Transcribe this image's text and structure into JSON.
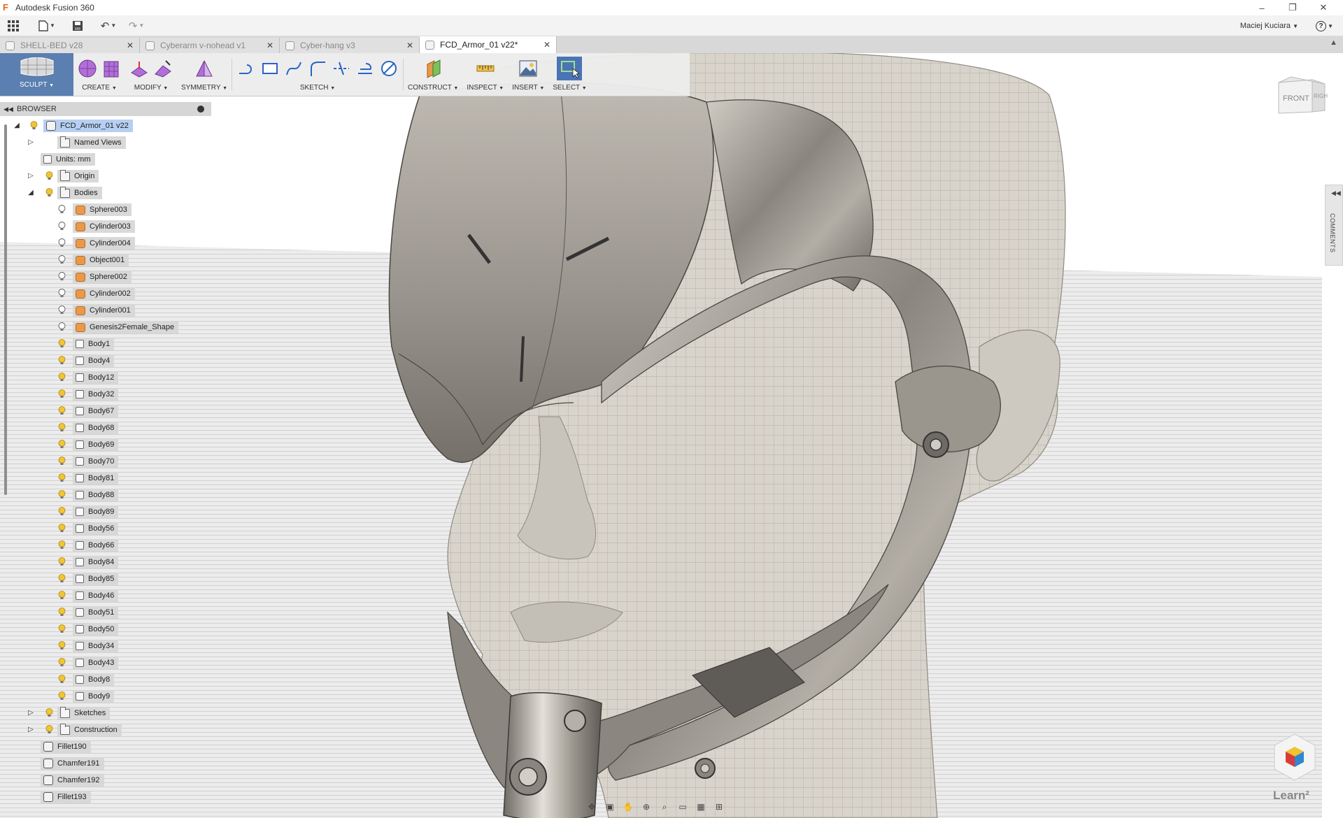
{
  "window": {
    "title": "Autodesk Fusion 360",
    "controls": [
      "–",
      "❐",
      "✕"
    ]
  },
  "quick_access": {
    "user_name": "Maciej Kuciara",
    "help_label": "?"
  },
  "tabs": [
    {
      "label": "SHELL-BED v28",
      "active": false
    },
    {
      "label": "Cyberarm v-nohead v1",
      "active": false
    },
    {
      "label": "Cyber-hang v3",
      "active": false
    },
    {
      "label": "FCD_Armor_01 v22*",
      "active": true
    }
  ],
  "toolbar": {
    "groups": [
      {
        "label": "SCULPT",
        "name": "sculpt"
      },
      {
        "label": "CREATE",
        "name": "create"
      },
      {
        "label": "MODIFY",
        "name": "modify"
      },
      {
        "label": "SYMMETRY",
        "name": "symmetry"
      },
      {
        "label": "SKETCH",
        "name": "sketch"
      },
      {
        "label": "CONSTRUCT",
        "name": "construct"
      },
      {
        "label": "INSPECT",
        "name": "inspect"
      },
      {
        "label": "INSERT",
        "name": "insert"
      },
      {
        "label": "SELECT",
        "name": "select"
      }
    ]
  },
  "browser": {
    "title": "BROWSER",
    "root": "FCD_Armor_01 v22",
    "items": [
      {
        "label": "Named Views",
        "type": "folder",
        "level": 1,
        "expander": "right",
        "bulb": false
      },
      {
        "label": "Units: mm",
        "type": "doc",
        "level": 1,
        "expander": "",
        "bulb": false
      },
      {
        "label": "Origin",
        "type": "folder",
        "level": 1,
        "expander": "right",
        "bulb": true
      },
      {
        "label": "Bodies",
        "type": "folder",
        "level": 1,
        "expander": "down",
        "bulb": true
      },
      {
        "label": "Sphere003",
        "type": "mesh",
        "level": 2,
        "bulb": true
      },
      {
        "label": "Cylinder003",
        "type": "mesh",
        "level": 2,
        "bulb": true
      },
      {
        "label": "Cylinder004",
        "type": "mesh",
        "level": 2,
        "bulb": true
      },
      {
        "label": "Object001",
        "type": "mesh",
        "level": 2,
        "bulb": true
      },
      {
        "label": "Sphere002",
        "type": "mesh",
        "level": 2,
        "bulb": true
      },
      {
        "label": "Cylinder002",
        "type": "mesh",
        "level": 2,
        "bulb": true
      },
      {
        "label": "Cylinder001",
        "type": "mesh",
        "level": 2,
        "bulb": true
      },
      {
        "label": "Genesis2Female_Shape",
        "type": "mesh",
        "level": 2,
        "bulb": true
      },
      {
        "label": "Body1",
        "type": "body",
        "level": 2,
        "bulb": true
      },
      {
        "label": "Body4",
        "type": "body",
        "level": 2,
        "bulb": true
      },
      {
        "label": "Body12",
        "type": "body",
        "level": 2,
        "bulb": true
      },
      {
        "label": "Body32",
        "type": "body",
        "level": 2,
        "bulb": true
      },
      {
        "label": "Body67",
        "type": "body",
        "level": 2,
        "bulb": true
      },
      {
        "label": "Body68",
        "type": "body",
        "level": 2,
        "bulb": true
      },
      {
        "label": "Body69",
        "type": "body",
        "level": 2,
        "bulb": true
      },
      {
        "label": "Body70",
        "type": "body",
        "level": 2,
        "bulb": true
      },
      {
        "label": "Body81",
        "type": "body",
        "level": 2,
        "bulb": true
      },
      {
        "label": "Body88",
        "type": "body",
        "level": 2,
        "bulb": true
      },
      {
        "label": "Body89",
        "type": "body",
        "level": 2,
        "bulb": true
      },
      {
        "label": "Body56",
        "type": "body",
        "level": 2,
        "bulb": true
      },
      {
        "label": "Body66",
        "type": "body",
        "level": 2,
        "bulb": true
      },
      {
        "label": "Body84",
        "type": "body",
        "level": 2,
        "bulb": true
      },
      {
        "label": "Body85",
        "type": "body",
        "level": 2,
        "bulb": true
      },
      {
        "label": "Body46",
        "type": "body",
        "level": 2,
        "bulb": true
      },
      {
        "label": "Body51",
        "type": "body",
        "level": 2,
        "bulb": true
      },
      {
        "label": "Body50",
        "type": "body",
        "level": 2,
        "bulb": true
      },
      {
        "label": "Body34",
        "type": "body",
        "level": 2,
        "bulb": true
      },
      {
        "label": "Body43",
        "type": "body",
        "level": 2,
        "bulb": true
      },
      {
        "label": "Body8",
        "type": "body",
        "level": 2,
        "bulb": true
      },
      {
        "label": "Body9",
        "type": "body",
        "level": 2,
        "bulb": true
      },
      {
        "label": "Sketches",
        "type": "folder",
        "level": 1,
        "expander": "right",
        "bulb": true
      },
      {
        "label": "Construction",
        "type": "folder",
        "level": 1,
        "expander": "right",
        "bulb": true
      },
      {
        "label": "Fillet190",
        "type": "feature",
        "level": 1,
        "bulb": false
      },
      {
        "label": "Chamfer191",
        "type": "feature",
        "level": 1,
        "bulb": false
      },
      {
        "label": "Chamfer192",
        "type": "feature",
        "level": 1,
        "bulb": false
      },
      {
        "label": "Fillet193",
        "type": "feature",
        "level": 1,
        "bulb": false
      }
    ]
  },
  "viewcube": {
    "front_label": "FRONT",
    "right_label": "RIGHT"
  },
  "comments_label": "COMMENTS",
  "learn_label": "Learn²",
  "colors": {
    "accent": "#5a7fb0",
    "selection": "#b6cff2",
    "mesh_icon": "#e89a4a",
    "bulb": "#f2c531"
  }
}
